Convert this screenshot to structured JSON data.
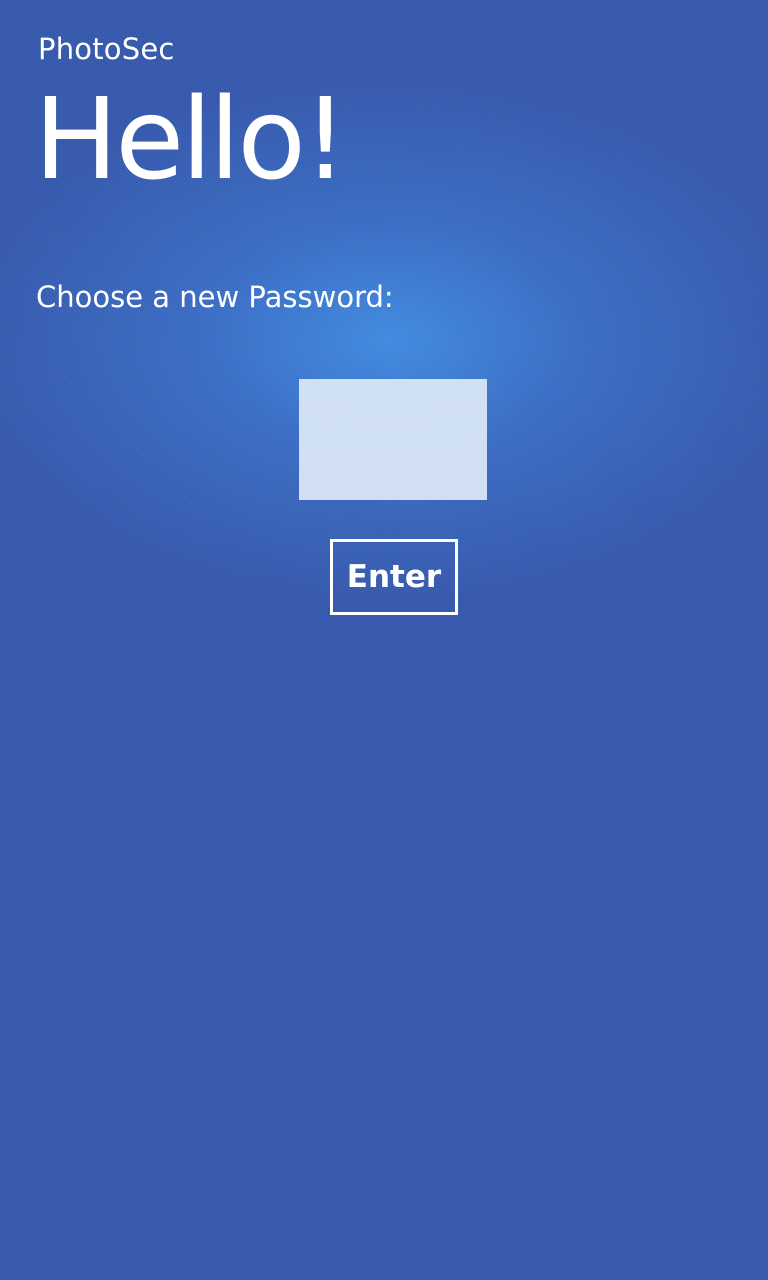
{
  "app": {
    "name": "PhotoSec"
  },
  "page": {
    "title": "Hello!",
    "prompt": "Choose a new Password:"
  },
  "password_field": {
    "value": "",
    "placeholder": ""
  },
  "enter_button": {
    "label": "Enter"
  },
  "colors": {
    "background": "#3558ac",
    "background_glow": "#3f8ae0",
    "input_background": "#e1ecf8",
    "text": "#ffffff"
  }
}
